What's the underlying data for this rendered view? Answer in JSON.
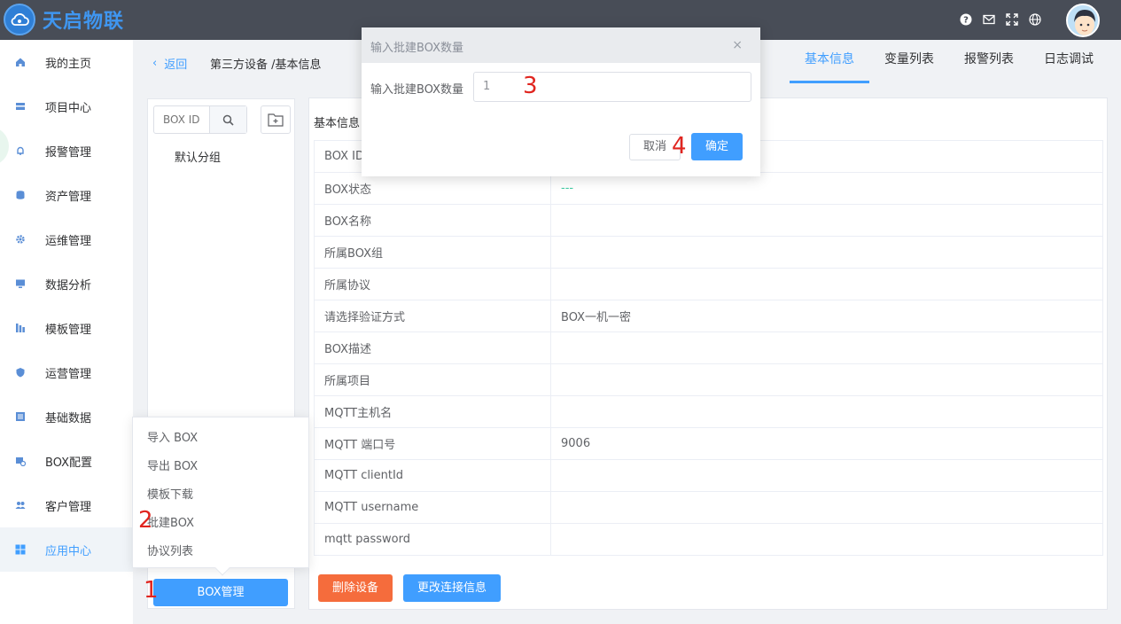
{
  "app": {
    "brand": "天启物联",
    "accent": "#409eff",
    "topbar_color": "#484d57"
  },
  "topbar": {
    "icons": [
      "help-icon",
      "mail-icon",
      "fullscreen-icon",
      "globe-icon"
    ]
  },
  "sidebar": {
    "items": [
      {
        "label": "我的主页",
        "icon": "home-icon"
      },
      {
        "label": "项目中心",
        "icon": "project-icon"
      },
      {
        "label": "报警管理",
        "icon": "bell-icon"
      },
      {
        "label": "资产管理",
        "icon": "asset-icon"
      },
      {
        "label": "运维管理",
        "icon": "gear-icon"
      },
      {
        "label": "数据分析",
        "icon": "monitor-icon"
      },
      {
        "label": "模板管理",
        "icon": "template-icon"
      },
      {
        "label": "运营管理",
        "icon": "shield-icon"
      },
      {
        "label": "基础数据",
        "icon": "data-icon"
      },
      {
        "label": "BOX配置",
        "icon": "box-config-icon"
      },
      {
        "label": "客户管理",
        "icon": "users-icon"
      },
      {
        "label": "应用中心",
        "icon": "apps-icon"
      }
    ],
    "active": "应用中心"
  },
  "header": {
    "back": "返回",
    "breadcrumb": "第三方设备 /基本信息",
    "tabs": [
      "基本信息",
      "变量列表",
      "报警列表",
      "日志调试"
    ],
    "active_tab": "基本信息"
  },
  "left_panel": {
    "search_placeholder": "BOX ID",
    "tree_root": "默认分组"
  },
  "popup_menu": {
    "items": [
      "导入 BOX",
      "导出 BOX",
      "模板下载",
      "批建BOX",
      "协议列表"
    ]
  },
  "box_manage_button": "BOX管理",
  "info": {
    "section_title": "基本信息",
    "rows": [
      {
        "key": "BOX ID",
        "value": ""
      },
      {
        "key": "BOX状态",
        "value": "---"
      },
      {
        "key": "BOX名称",
        "value": ""
      },
      {
        "key": "所属BOX组",
        "value": ""
      },
      {
        "key": "所属协议",
        "value": ""
      },
      {
        "key": "请选择验证方式",
        "value": "BOX一机一密"
      },
      {
        "key": "BOX描述",
        "value": ""
      },
      {
        "key": "所属项目",
        "value": ""
      },
      {
        "key": "MQTT主机名",
        "value": ""
      },
      {
        "key": "MQTT 端口号",
        "value": "9006"
      },
      {
        "key": "MQTT clientId",
        "value": ""
      },
      {
        "key": "MQTT username",
        "value": ""
      },
      {
        "key": "mqtt password",
        "value": ""
      }
    ],
    "delete_button": "删除设备",
    "edit_button": "更改连接信息"
  },
  "dialog": {
    "title": "输入批建BOX数量",
    "label": "输入批建BOX数量",
    "input_value": "1",
    "cancel": "取消",
    "ok": "确定",
    "close": "×"
  },
  "annotations": [
    "1",
    "2",
    "3",
    "4"
  ]
}
